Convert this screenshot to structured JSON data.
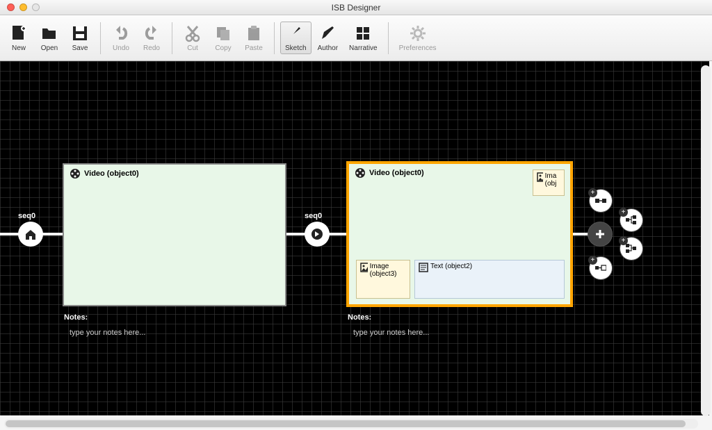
{
  "window": {
    "title": "ISB Designer"
  },
  "toolbar": {
    "new": "New",
    "open": "Open",
    "save": "Save",
    "undo": "Undo",
    "redo": "Redo",
    "cut": "Cut",
    "copy": "Copy",
    "paste": "Paste",
    "sketch": "Sketch",
    "author": "Author",
    "narrative": "Narrative",
    "preferences": "Preferences"
  },
  "canvas": {
    "seq0_label_left": "seq0",
    "seq0_label_right": "seq0",
    "panel1": {
      "title": "Video (object0)",
      "notes_label": "Notes:",
      "notes_placeholder": "type your notes here..."
    },
    "panel2": {
      "title": "Video (object0)",
      "notes_label": "Notes:",
      "notes_placeholder": "type your notes here...",
      "item_ima": "Ima (obj",
      "item_image": "Image (object3)",
      "item_text": "Text (object2)"
    }
  }
}
